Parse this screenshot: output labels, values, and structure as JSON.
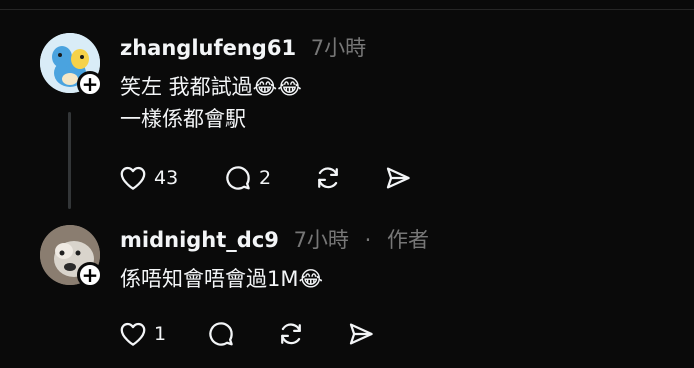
{
  "comments": [
    {
      "username": "zhanglufeng61",
      "time": "7小時",
      "lines": [
        "笑左 我都試過😂😂",
        "一樣係都會駅"
      ],
      "likes": "43",
      "replies": "2"
    },
    {
      "username": "midnight_dc9",
      "time": "7小時",
      "separator": "·",
      "author_badge": "作者",
      "lines": [
        "係唔知會唔會過1M😂"
      ],
      "likes": "1"
    }
  ],
  "icons": {
    "follow": "plus-icon",
    "like": "heart-icon",
    "reply": "comment-icon",
    "repost": "repost-icon",
    "share": "send-icon"
  }
}
